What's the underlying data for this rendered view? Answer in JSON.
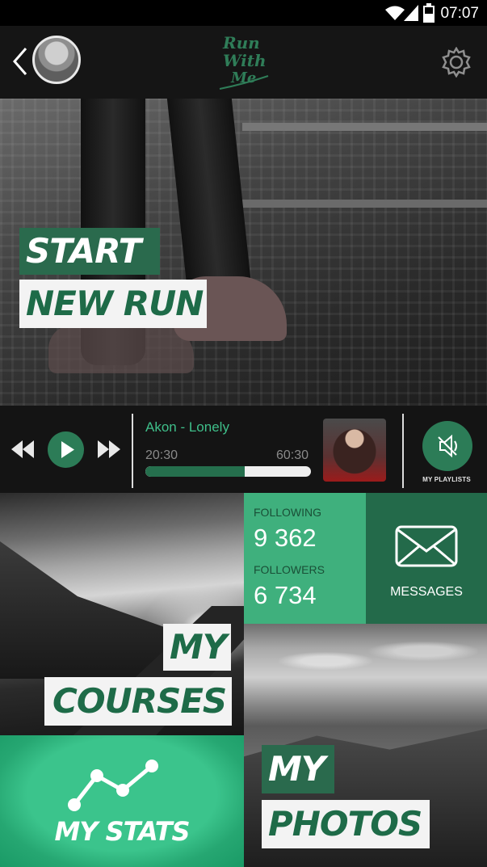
{
  "status_bar": {
    "time": "07:07"
  },
  "app_bar": {
    "logo_lines": [
      "Run",
      "With",
      "Me"
    ]
  },
  "hero": {
    "line1": "START",
    "line2": "NEW RUN"
  },
  "player": {
    "track": "Akon - Lonely",
    "elapsed": "20:30",
    "total": "60:30",
    "progress_fraction": 0.6,
    "playlists_label": "MY PLAYLISTS"
  },
  "courses": {
    "line1": "MY",
    "line2": "COURSES"
  },
  "social": {
    "following_label": "FOLLOWING",
    "following_value": "9 362",
    "followers_label": "FOLLOWERS",
    "followers_value": "6 734"
  },
  "messages": {
    "label": "MESSAGES"
  },
  "stats": {
    "label": "MY STATS"
  },
  "photos": {
    "line1": "MY",
    "line2": "PHOTOS"
  },
  "colors": {
    "accent": "#2c7c57",
    "accent_light": "#3fb07d",
    "accent_dark": "#236a4a"
  }
}
